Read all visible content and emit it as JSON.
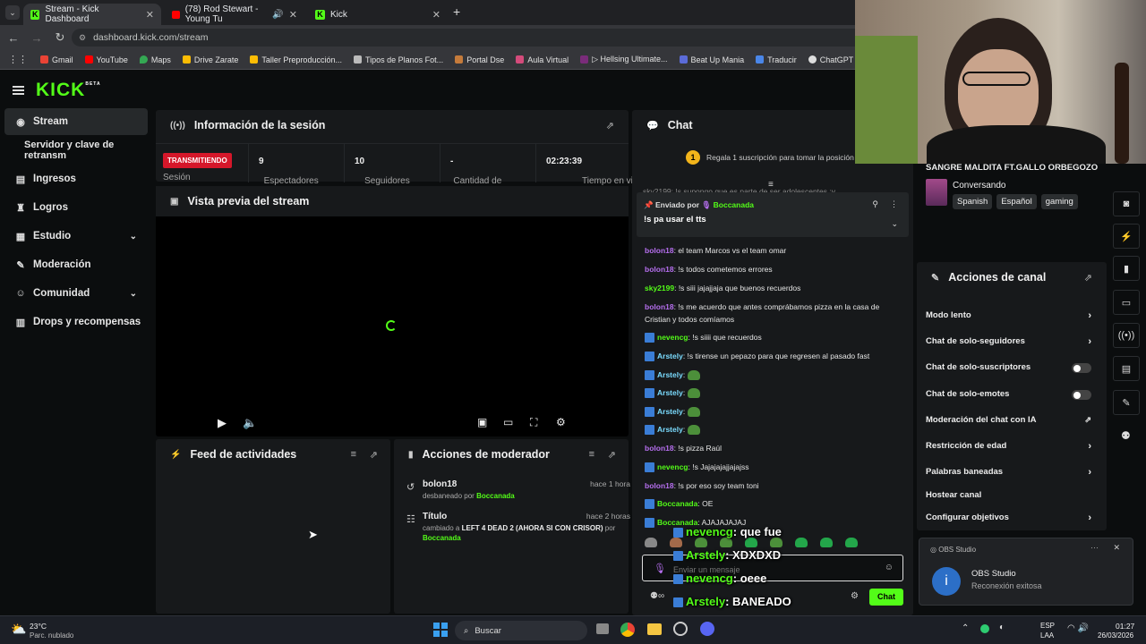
{
  "browser": {
    "tabs": [
      {
        "label": "Stream - Kick Dashboard",
        "active": true
      },
      {
        "label": "(78) Rod Stewart - Young Tu",
        "active": false
      },
      {
        "label": "Kick",
        "active": false
      }
    ],
    "url": "dashboard.kick.com/stream",
    "bookmarks": [
      "Gmail",
      "YouTube",
      "Maps",
      "Drive Zarate",
      "Taller Preproducción...",
      "Tipos de Planos Fot...",
      "Portal Dse",
      "Aula Virtual",
      "▷ Hellsing Ultimate...",
      "Beat Up Mania",
      "Traducir",
      "ChatGPT"
    ]
  },
  "app": {
    "logo": "KICK",
    "logo_sup": "BETA",
    "sidebar": [
      {
        "label": "Stream",
        "icon": "broadcast-icon"
      },
      {
        "label": "Servidor y clave de retransm",
        "icon": ""
      },
      {
        "label": "Ingresos",
        "icon": "revenue-icon"
      },
      {
        "label": "Logros",
        "icon": "trophy-icon"
      },
      {
        "label": "Estudio",
        "icon": "studio-icon"
      },
      {
        "label": "Moderación",
        "icon": "wrench-icon"
      },
      {
        "label": "Comunidad",
        "icon": "community-icon"
      },
      {
        "label": "Drops y recompensas",
        "icon": "drops-icon"
      }
    ]
  },
  "session": {
    "title": "Información de la sesión",
    "badge": "TRANSMITIENDO",
    "badge_label": "Sesión",
    "stats": [
      {
        "value": "9",
        "label": "Espectadores"
      },
      {
        "value": "10",
        "label": "Seguidores"
      },
      {
        "value": "-",
        "label": "Cantidad de"
      },
      {
        "value": "02:23:39",
        "label": "Tiempo en vivo"
      }
    ]
  },
  "preview": {
    "title": "Vista previa del stream"
  },
  "feed": {
    "title": "Feed de actividades"
  },
  "modactions": {
    "title": "Acciones de moderador",
    "items": [
      {
        "name": "bolon18",
        "desc_pre": "desbaneado por ",
        "desc_user": "Boccanada",
        "desc_post": "",
        "time": "hace 1 hora"
      },
      {
        "name": "Título",
        "desc_pre": "cambiado a ",
        "desc_bold": "LEFT 4 DEAD 2 (AHORA SI CON CRISOR)",
        "desc_mid": " por ",
        "desc_user": "Boccanada",
        "time": "hace 2 horas"
      }
    ]
  },
  "chat": {
    "title": "Chat",
    "promo_num": "1",
    "promo": "Regala 1 suscripción para tomar la posición",
    "cut_line": "sky2199: !s supongo que es parte de ser adolescentes :v",
    "pinned_by": "Enviado por",
    "pinned_user": "Boccanada",
    "pinned_msg": "!s pa usar el tts",
    "messages": [
      {
        "user": "bolon18",
        "text": ": el team Marcos vs el team omar",
        "color": "purp",
        "badge": false
      },
      {
        "user": "bolon18",
        "text": ": !s todos cometemos errores",
        "color": "purp",
        "badge": false
      },
      {
        "user": "sky2199",
        "text": ": !s siii jajajjaja que buenos recuerdos",
        "color": "grn",
        "badge": false
      },
      {
        "user": "bolon18",
        "text": ": !s me acuerdo que antes comprábamos pizza en la casa de Cristian y todos comíamos",
        "color": "purp",
        "badge": false
      },
      {
        "user": "nevencg",
        "text": ": !s siiii que recuerdos",
        "color": "grn",
        "badge": true
      },
      {
        "user": "Arstely",
        "text": ": !s tirense un pepazo para que regresen al pasado fast",
        "color": "blu",
        "badge": true
      },
      {
        "user": "Arstely",
        "text": ": ",
        "color": "blu",
        "badge": true,
        "emote": true
      },
      {
        "user": "Arstely",
        "text": ": ",
        "color": "blu",
        "badge": true,
        "emote": true
      },
      {
        "user": "Arstely",
        "text": ": ",
        "color": "blu",
        "badge": true,
        "emote": true
      },
      {
        "user": "Arstely",
        "text": ": ",
        "color": "blu",
        "badge": true,
        "emote": true
      },
      {
        "user": "bolon18",
        "text": ": !s pizza Raúl",
        "color": "purp",
        "badge": false
      },
      {
        "user": "nevencg",
        "text": ": !s Jajajajajjajajss",
        "color": "grn",
        "badge": true
      },
      {
        "user": "bolon18",
        "text": ": !s por eso soy team toni",
        "color": "purp",
        "badge": false
      },
      {
        "user": "Boccanada",
        "text": ": OE",
        "color": "grn",
        "badge": true
      },
      {
        "user": "Boccanada",
        "text": ": AJAJAJAJAJ",
        "color": "grn",
        "badge": true
      }
    ],
    "input_placeholder": "Enviar un mensaje",
    "send_label": "Chat"
  },
  "overlay_chat": [
    {
      "user": "nevencg",
      "text": ": que fue"
    },
    {
      "user": "Arstely",
      "text": ": XDXDXD"
    },
    {
      "user": "nevencg",
      "text": ": oeee"
    },
    {
      "user": "Arstely",
      "text": ": BANEADO"
    }
  ],
  "stream_info": {
    "title": "SANGRE MALDITA FT.GALLO ORBEGOZO",
    "category": "Conversando",
    "tags": [
      "Spanish",
      "Español",
      "gaming"
    ]
  },
  "channel_actions": {
    "title": "Acciones de canal",
    "items": [
      {
        "label": "Modo lento",
        "type": "arrow"
      },
      {
        "label": "Chat de solo-seguidores",
        "type": "arrow"
      },
      {
        "label": "Chat de solo-suscriptores",
        "type": "toggle"
      },
      {
        "label": "Chat de solo-emotes",
        "type": "toggle"
      },
      {
        "label": "Moderación del chat con IA",
        "type": "link"
      },
      {
        "label": "Restricción de edad",
        "type": "arrow"
      },
      {
        "label": "Palabras baneadas",
        "type": "arrow"
      },
      {
        "label": "Hostear canal",
        "type": "none"
      },
      {
        "label": "Configurar objetivos",
        "type": "arrow"
      }
    ]
  },
  "notification": {
    "app": "OBS Studio",
    "title": "OBS Studio",
    "body": "Reconexión exitosa"
  },
  "taskbar": {
    "temp": "23°C",
    "weather": "Parc. nublado",
    "search": "Buscar",
    "lang1": "ESP",
    "lang2": "LAA",
    "time": "01:27",
    "date": "26/03/2026"
  }
}
